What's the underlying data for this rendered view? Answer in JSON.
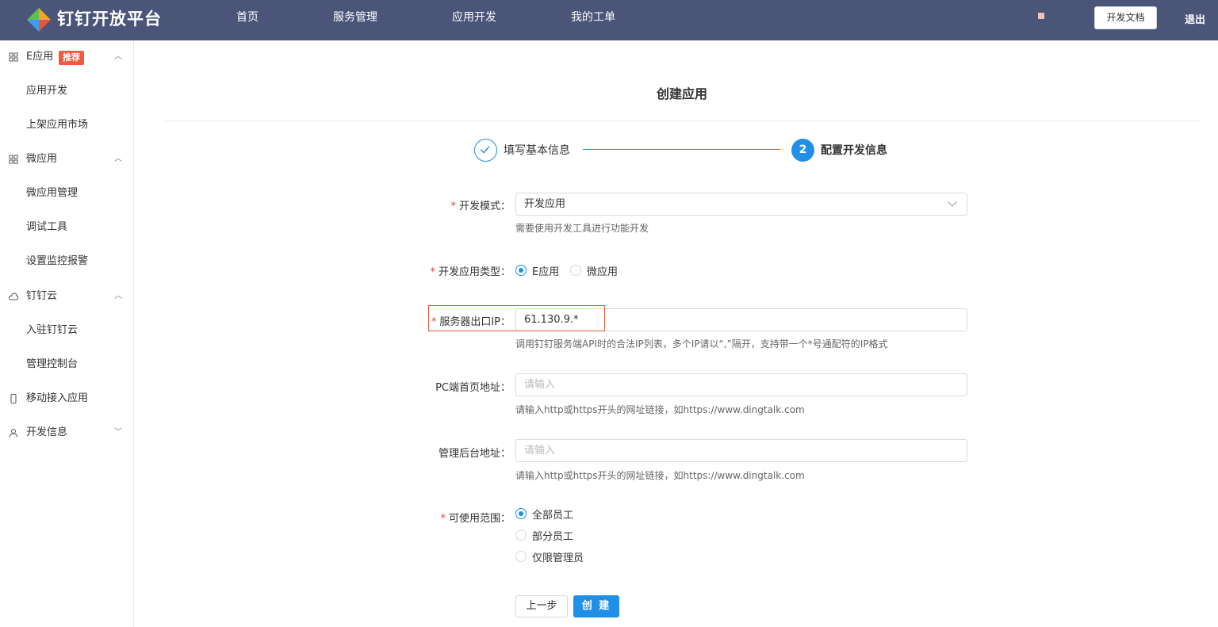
{
  "header": {
    "brand": "钉钉开放平台",
    "nav": [
      "首页",
      "服务管理",
      "应用开发",
      "我的工单"
    ],
    "doc_button": "开发文档",
    "logout": "退出"
  },
  "sidebar": {
    "groups": [
      {
        "label": "E应用",
        "badge": "推荐",
        "icon": "grid-icon",
        "expanded": true,
        "items": [
          "应用开发",
          "上架应用市场"
        ]
      },
      {
        "label": "微应用",
        "icon": "grid-icon",
        "expanded": true,
        "items": [
          "微应用管理",
          "调试工具",
          "设置监控报警"
        ]
      },
      {
        "label": "钉钉云",
        "icon": "cloud-icon",
        "expanded": true,
        "items": [
          "入驻钉钉云",
          "管理控制台"
        ]
      },
      {
        "label": "移动接入应用",
        "icon": "mobile-icon"
      },
      {
        "label": "开发信息",
        "icon": "user-icon",
        "expanded": false
      }
    ]
  },
  "page": {
    "title": "创建应用",
    "steps": [
      {
        "label": "填写基本信息",
        "status": "done"
      },
      {
        "number": "2",
        "label": "配置开发信息",
        "status": "active"
      }
    ]
  },
  "form": {
    "dev_mode": {
      "label": "开发模式：",
      "value": "开发应用",
      "hint": "需要使用开发工具进行功能开发"
    },
    "app_type": {
      "label": "开发应用类型：",
      "options": [
        "E应用",
        "微应用"
      ],
      "selected": "E应用"
    },
    "server_ip": {
      "label": "服务器出口IP：",
      "value": "61.130.9.*",
      "hint": "调用钉钉服务端API时的合法IP列表，多个IP请以“,”隔开，支持带一个*号通配符的IP格式"
    },
    "pc_home": {
      "label": "PC端首页地址：",
      "placeholder": "请输入",
      "hint": "请输入http或https开头的网址链接，如https://www.dingtalk.com"
    },
    "admin_url": {
      "label": "管理后台地址：",
      "placeholder": "请输入",
      "hint": "请输入http或https开头的网址链接，如https://www.dingtalk.com"
    },
    "scope": {
      "label": "可使用范围：",
      "options": [
        "全部员工",
        "部分员工",
        "仅限管理员"
      ],
      "selected": "全部员工"
    },
    "prev_button": "上一步",
    "create_button": "创 建"
  },
  "colors": {
    "header_bg": "#4a5579",
    "primary": "#1f8fe8",
    "required": "#f04134",
    "badge": "#f0593e",
    "highlight_box": "#e8553a"
  }
}
